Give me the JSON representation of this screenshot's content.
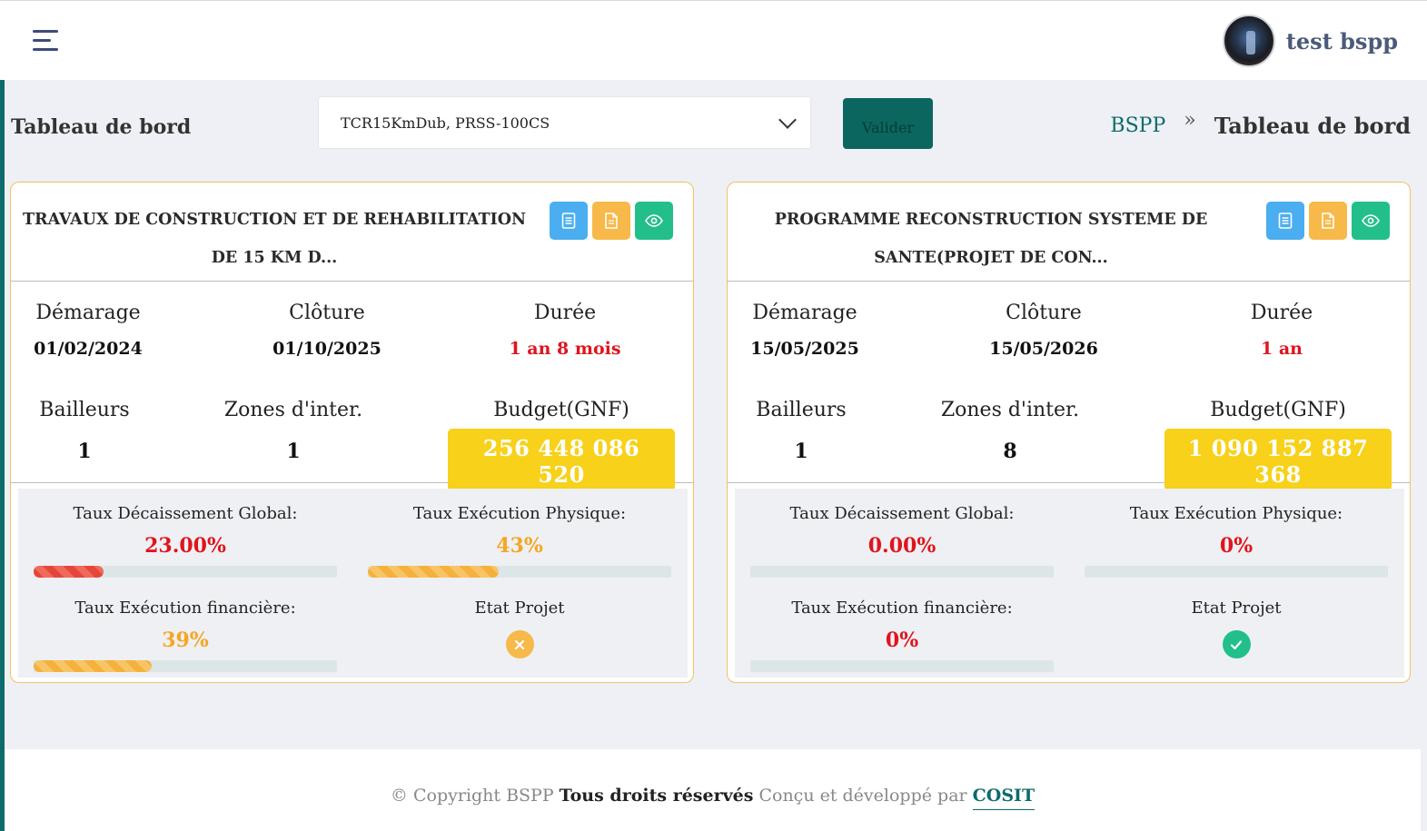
{
  "header": {
    "username": "test bspp"
  },
  "toolbar": {
    "page_title": "Tableau de bord",
    "project_select_value": "TCR15KmDub, PRSS-100CS",
    "validate_label": "Valider",
    "breadcrumb": {
      "home": "BSPP",
      "separator": "»",
      "current": "Tableau de bord"
    }
  },
  "labels": {
    "start": "Démarage",
    "end": "Clôture",
    "duration": "Durée",
    "donors": "Bailleurs",
    "zones": "Zones d'inter.",
    "budget": "Budget(GNF)",
    "disbursement": "Taux Décaissement Global:",
    "physical": "Taux Exécution Physique:",
    "financial": "Taux Exécution financière:",
    "state": "Etat Projet"
  },
  "projects": [
    {
      "title": "TRAVAUX DE CONSTRUCTION ET DE REHABILITATION DE 15 KM D...",
      "start_date": "01/02/2024",
      "end_date": "01/10/2025",
      "duration": "1 an 8 mois",
      "donors": "1",
      "zones": "1",
      "budget": "256 448 086 520",
      "disbursement_rate_text": "23.00%",
      "disbursement_rate": 0.23,
      "physical_rate_text": "43%",
      "physical_rate": 0.43,
      "financial_rate_text": "39%",
      "financial_rate": 0.39,
      "state": "x-circle-icon"
    },
    {
      "title": "PROGRAMME RECONSTRUCTION SYSTEME DE SANTE(PROJET DE CON...",
      "start_date": "15/05/2025",
      "end_date": "15/05/2026",
      "duration": "1 an",
      "donors": "1",
      "zones": "8",
      "budget": "1 090 152 887 368",
      "disbursement_rate_text": "0.00%",
      "disbursement_rate": 0,
      "physical_rate_text": "0%",
      "physical_rate": 0,
      "financial_rate_text": "0%",
      "financial_rate": 0,
      "state": "check-circle-icon"
    }
  ],
  "footer": {
    "copyright": "© Copyright BSPP",
    "rights": "Tous droits réservés",
    "designed_by": "Conçu et développé par",
    "brand": "COSIT"
  },
  "colors": {
    "accent": "#0d6b6b",
    "budget_badge": "#f7d11a",
    "danger": "#e0141d",
    "warning": "#f5a623",
    "success": "#22bf8a",
    "info": "#4aaef0"
  }
}
